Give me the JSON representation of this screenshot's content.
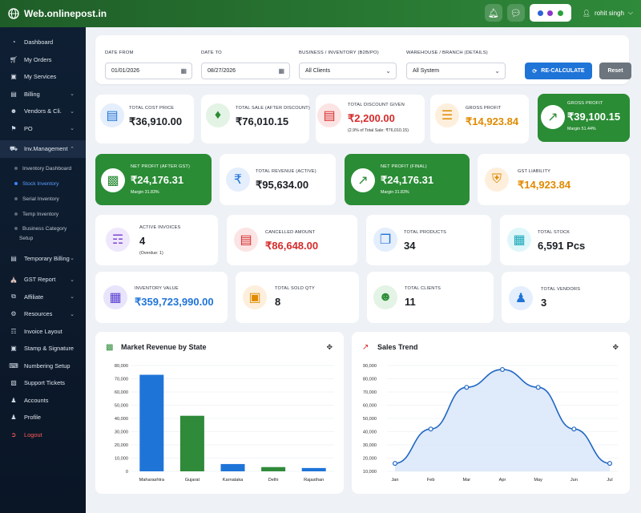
{
  "topbar": {
    "brand": "Web.onlinepost.in",
    "user": "rohit singh",
    "bell_icon": "bell-icon",
    "chat_icon": "wechat-icon"
  },
  "sidebar": {
    "items": [
      {
        "label": "Dashboard",
        "icon": "gauge-icon"
      },
      {
        "label": "My Orders",
        "icon": "cart-icon"
      },
      {
        "label": "My Services",
        "icon": "briefcase-icon"
      },
      {
        "label": "Billing",
        "icon": "wallet-icon"
      },
      {
        "label": "Vendors & Cli.",
        "icon": "users-icon"
      },
      {
        "label": "PO",
        "icon": "flag-icon"
      },
      {
        "label": "Inv.Management",
        "icon": "truck-icon"
      },
      {
        "label": "Temporary Billing",
        "icon": "receipt-icon"
      },
      {
        "label": "GST Report",
        "icon": "bank-icon"
      },
      {
        "label": "Affiliate",
        "icon": "share-icon"
      },
      {
        "label": "Resources",
        "icon": "gear-icon"
      },
      {
        "label": "Invoice Layout",
        "icon": "file-icon"
      },
      {
        "label": "Stamp & Signature",
        "icon": "stamp-icon"
      },
      {
        "label": "Numbering Setup",
        "icon": "keyboard-icon"
      },
      {
        "label": "Support Tickets",
        "icon": "ticket-icon"
      },
      {
        "label": "Accounts",
        "icon": "user-gear-icon"
      },
      {
        "label": "Profile",
        "icon": "user-icon"
      },
      {
        "label": "Logout",
        "icon": "logout-icon"
      }
    ],
    "sub_items": [
      "Inventory Dashboard",
      "Stock Inventory",
      "Serial Inventory",
      "Temp Inventory",
      "Business Category",
      "Setup"
    ]
  },
  "filters": {
    "date_from_label": "DATE FROM",
    "date_from": "01/01/2026",
    "date_to_label": "DATE TO",
    "date_to": "08/27/2026",
    "business_label": "BUSINESS / INVENTORY (B2B/PO)",
    "business_value": "All Clients",
    "warehouse_label": "WAREHOUSE / BRANCH (DETAILS)",
    "warehouse_value": "All System",
    "recalc_label": "RE-CALCULATE",
    "reset_label": "Reset"
  },
  "stats": {
    "total_cost_price": {
      "label": "TOTAL COST PRICE",
      "value": "₹36,910.00"
    },
    "total_sale": {
      "label": "TOTAL SALE (AFTER DISCOUNT)",
      "value": "₹76,010.15"
    },
    "total_discount": {
      "label": "TOTAL DISCOUNT GIVEN",
      "value": "₹2,200.00",
      "sub": "(2.9% of Total Sale: ₹76,010.15)"
    },
    "gross_profit": {
      "label": "GROSS PROFIT",
      "value": "₹14,923.84"
    },
    "gross_profit_green": {
      "label": "GROSS PROFIT",
      "value": "₹39,100.15",
      "sub": "Margin 51.44%"
    },
    "net_profit_after_gst": {
      "label": "NET PROFIT (AFTER GST)",
      "value": "₹24,176.31",
      "sub": "Margin 31.83%"
    },
    "total_revenue": {
      "label": "TOTAL REVENUE (ACTIVE)",
      "value": "₹95,634.00"
    },
    "net_profit_final": {
      "label": "NET PROFIT (FINAL)",
      "value": "₹24,176.31",
      "sub": "Margin 31.83%"
    },
    "gst_liability": {
      "label": "GST LIABILITY",
      "value": "₹14,923.84"
    },
    "active_invoices": {
      "label": "ACTIVE INVOICES",
      "value": "4",
      "sub": "(Overdue: 1)"
    },
    "cancelled_amount": {
      "label": "CANCELLED AMOUNT",
      "value": "₹86,648.00"
    },
    "total_products": {
      "label": "TOTAL PRODUCTS",
      "value": "34"
    },
    "total_stock": {
      "label": "TOTAL STOCK",
      "value": "6,591 Pcs"
    },
    "inventory_value": {
      "label": "INVENTORY VALUE",
      "value": "₹359,723,990.00"
    },
    "total_sold_qty": {
      "label": "TOTAL SOLD QTY",
      "value": "8"
    },
    "total_clients": {
      "label": "TOTAL CLIENTS",
      "value": "11"
    },
    "total_vendors": {
      "label": "TOTAL VENDORS",
      "value": "3"
    }
  },
  "chart_data": [
    {
      "type": "bar",
      "title": "Market Revenue by State",
      "categories": [
        "Maharashtra",
        "Gujarat",
        "Karnataka",
        "Delhi",
        "Rajasthan"
      ],
      "values": [
        73000,
        42000,
        5500,
        3200,
        2500
      ],
      "colors": [
        "#1f74d8",
        "#2f8a3a",
        "#1f74d8",
        "#2f8a3a",
        "#1f74d8"
      ],
      "ylim": [
        0,
        80000
      ],
      "yticks": [
        0,
        10000,
        20000,
        30000,
        40000,
        50000,
        60000,
        70000,
        80000
      ],
      "ytick_labels": [
        "0",
        "10,000",
        "20,000",
        "30,000",
        "40,000",
        "50,000",
        "60,000",
        "70,000",
        "80,000"
      ],
      "grid": true
    },
    {
      "type": "area",
      "title": "Sales Trend",
      "categories": [
        "Jan",
        "Feb",
        "Mar",
        "Apr",
        "May",
        "Jun",
        "Jul"
      ],
      "values": [
        16000,
        42000,
        73500,
        87000,
        73500,
        42000,
        16000
      ],
      "ylim": [
        10000,
        90000
      ],
      "yticks": [
        10000,
        20000,
        30000,
        40000,
        50000,
        60000,
        70000,
        80000,
        90000
      ],
      "ytick_labels": [
        "10,000",
        "20,000",
        "30,000",
        "40,000",
        "50,000",
        "60,000",
        "70,000",
        "80,000",
        "90,000"
      ],
      "line_color": "#1f66c4",
      "fill_color": "#dbe8f9",
      "grid": true
    }
  ]
}
